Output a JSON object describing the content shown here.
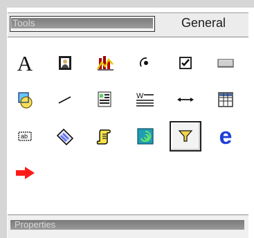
{
  "toolbar": {
    "tools_label": "Tools",
    "general_label": "General"
  },
  "tool_icons": [
    [
      "text-tool-icon",
      "portrait-tool-icon",
      "chart-tool-icon",
      "radio-tool-icon",
      "checkbox-tool-icon",
      "button-tool-icon"
    ],
    [
      "shapes-tool-icon",
      "line-tool-icon",
      "document-tool-icon",
      "word-tool-icon",
      "horizontal-arrow-tool-icon",
      "grid-tool-icon"
    ],
    [
      "textbox-tool-icon",
      "eraser-tool-icon",
      "scroll-tool-icon",
      "spiral-tool-icon",
      "filter-tool-icon",
      "browser-tool-icon"
    ],
    [
      "red-arrow-tool-icon"
    ]
  ],
  "tool_symbols": {
    "text": "A",
    "browser": "e"
  },
  "properties": {
    "title": "Properties"
  }
}
